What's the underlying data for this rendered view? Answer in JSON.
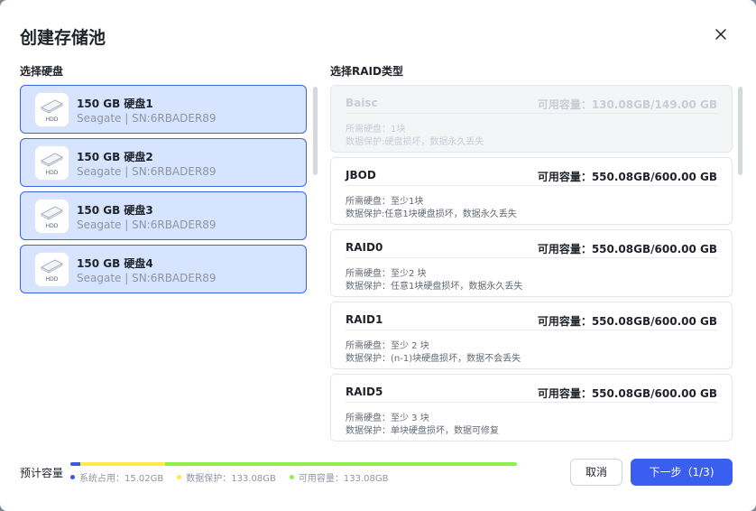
{
  "dialog": {
    "title": "创建存储池",
    "close_icon": "close-icon"
  },
  "disks_section": {
    "label": "选择硬盘",
    "items": [
      {
        "name": "150 GB  硬盘1",
        "sub": "Seagate | SN:6RBADER89",
        "icon_label": "HDD",
        "selected": true
      },
      {
        "name": "150 GB  硬盘2",
        "sub": "Seagate | SN:6RBADER89",
        "icon_label": "HDD",
        "selected": true
      },
      {
        "name": "150 GB  硬盘3",
        "sub": "Seagate | SN:6RBADER89",
        "icon_label": "HDD",
        "selected": true
      },
      {
        "name": "150 GB  硬盘4",
        "sub": "Seagate | SN:6RBADER89",
        "icon_label": "HDD",
        "selected": true
      }
    ]
  },
  "raid_section": {
    "label": "选择RAID类型",
    "items": [
      {
        "name": "Baisc",
        "capacity": "可用容量：130.08GB/149.00 GB",
        "requirement": "所需硬盘：1块",
        "protection": "数据保护:硬盘损坏，数据永久丢失",
        "disabled": true
      },
      {
        "name": "JBOD",
        "capacity": "可用容量：550.08GB/600.00 GB",
        "requirement": "所需硬盘：至少1块",
        "protection": "数据保护:任意1块硬盘损坏，数据永久丢失",
        "disabled": false
      },
      {
        "name": "RAID0",
        "capacity": "可用容量：550.08GB/600.00 GB",
        "requirement": "所需硬盘：至少2 块",
        "protection": "数据保护：任意1块硬盘损坏，数据永久丢失",
        "disabled": false
      },
      {
        "name": "RAID1",
        "capacity": "可用容量：550.08GB/600.00 GB",
        "requirement": "所需硬盘：至少 2 块",
        "protection": "数据保护：(n-1)块硬盘损坏，数据不会丢失",
        "disabled": false
      },
      {
        "name": "RAID5",
        "capacity": "可用容量：550.08GB/600.00 GB",
        "requirement": "所需硬盘：至少 3 块",
        "protection": "数据保护：单块硬盘损坏，数据可修复",
        "disabled": false
      }
    ]
  },
  "footer": {
    "capacity_label": "预计容量",
    "bar": [
      {
        "name": "系统占用",
        "value_gb": 15.02,
        "color": "#3b5bdb"
      },
      {
        "name": "数据保护",
        "value_gb": 133.08,
        "color": "#ffe94d"
      },
      {
        "name": "可用容量",
        "value_gb": 550.08,
        "color": "#8ff04b"
      }
    ],
    "legend": [
      {
        "text": "系统占用：15.02GB",
        "color": "#3b5bdb"
      },
      {
        "text": "数据保护：133.08GB",
        "color": "#ffe94d"
      },
      {
        "text": "可用容量：133.08GB",
        "color": "#8ff04b"
      }
    ],
    "cancel_label": "取消",
    "next_label": "下一步（1/3)"
  }
}
